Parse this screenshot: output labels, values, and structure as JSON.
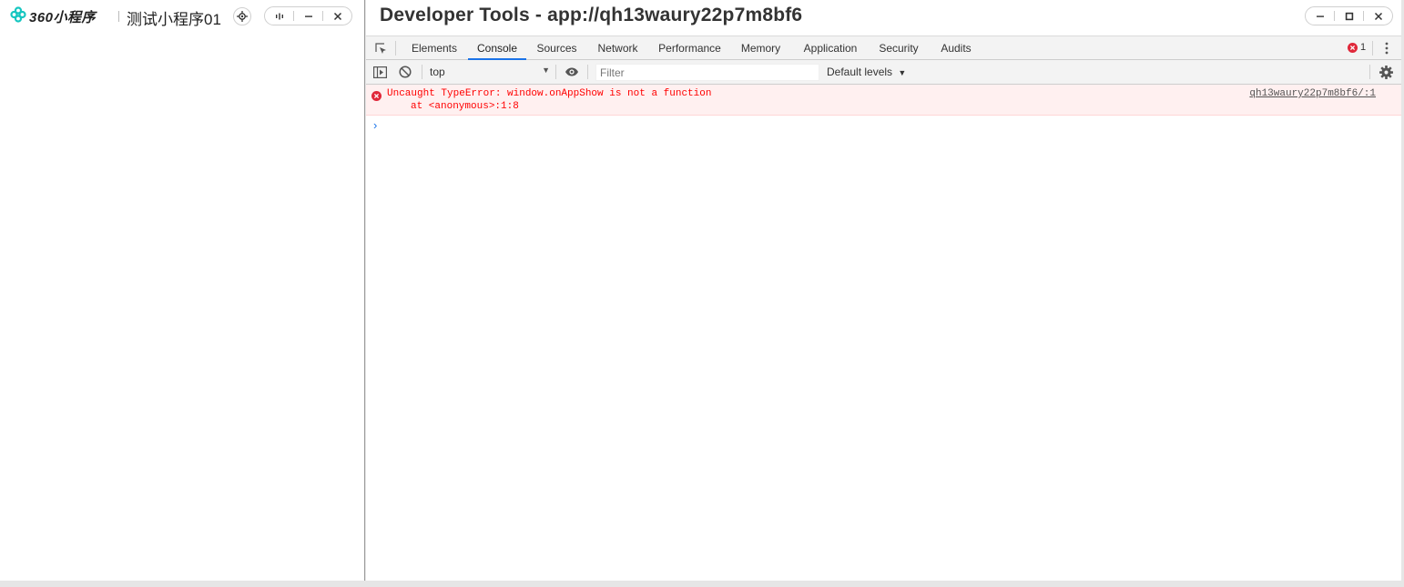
{
  "miniprogram": {
    "logo_text": "360小程序",
    "title": "测试小程序01"
  },
  "devtools": {
    "title": "Developer Tools - app://qh13waury22p7m8bf6",
    "tabs": [
      "Elements",
      "Console",
      "Sources",
      "Network",
      "Performance",
      "Memory",
      "Application",
      "Security",
      "Audits"
    ],
    "active_tab": "Console",
    "error_count": "1",
    "toolbar": {
      "context": "top",
      "filter_placeholder": "Filter",
      "levels": "Default levels"
    },
    "console": {
      "error_message": "Uncaught TypeError: window.onAppShow is not a function",
      "error_stack": "at <anonymous>:1:8",
      "error_source": "qh13waury22p7m8bf6/:1",
      "prompt": "›"
    }
  },
  "colors": {
    "accent": "#1a73e8",
    "error": "#ff0000",
    "error_bg": "#fff0f0",
    "logo_cyan": "#15c6c0"
  }
}
